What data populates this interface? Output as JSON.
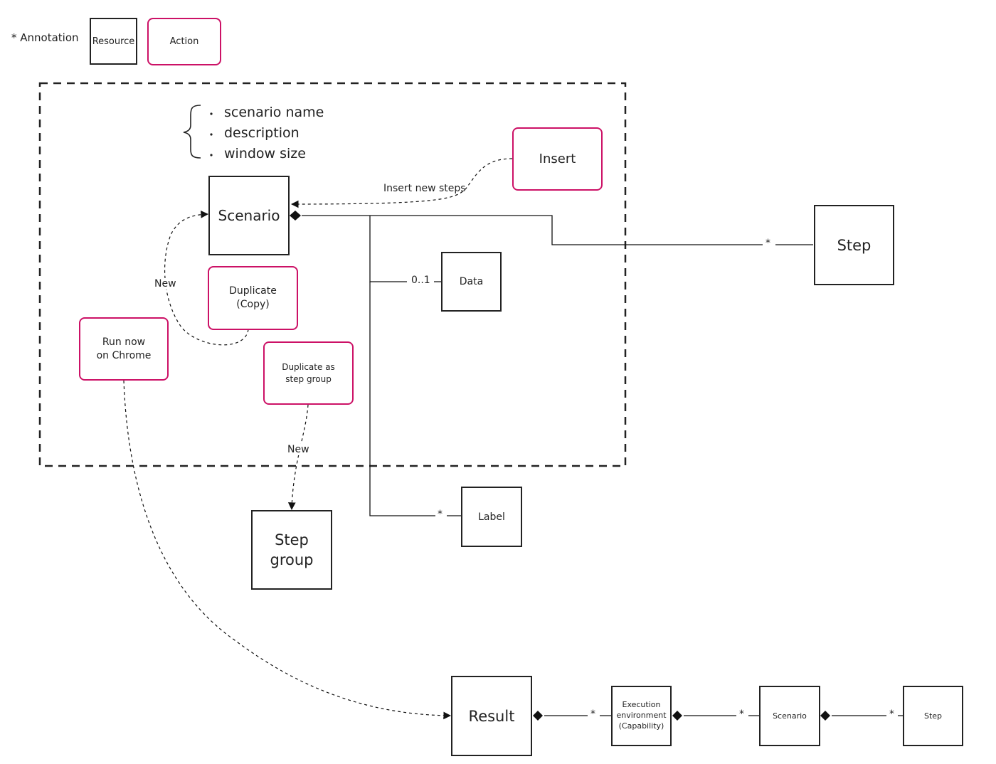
{
  "legend": {
    "annotation": "* Annotation",
    "resource": "Resource",
    "action": "Action"
  },
  "colors": {
    "action_border": "#cc1166",
    "resource_border": "#222222",
    "line": "#111111"
  },
  "attributes": [
    "scenario name",
    "description",
    "window size"
  ],
  "resources": {
    "scenario": "Scenario",
    "step": "Step",
    "data": "Data",
    "label": "Label",
    "step_group": "Step\ngroup",
    "result": "Result",
    "execution_environment": "Execution\nenvironment\n(Capability)",
    "scenario_small": "Scenario",
    "step_small": "Step"
  },
  "actions": {
    "insert": "Insert",
    "duplicate_copy": "Duplicate\n(Copy)",
    "run_now": "Run now\non Chrome",
    "duplicate_step_group": "Duplicate as\nstep group"
  },
  "edge_labels": {
    "insert_new_steps": "Insert new steps",
    "new_duplicate": "New",
    "new_step_group": "New",
    "multiplicity_step": "*",
    "multiplicity_data": "0..1",
    "multiplicity_label": "*",
    "multiplicity_env": "*",
    "multiplicity_scenario": "*",
    "multiplicity_step_small": "*"
  }
}
